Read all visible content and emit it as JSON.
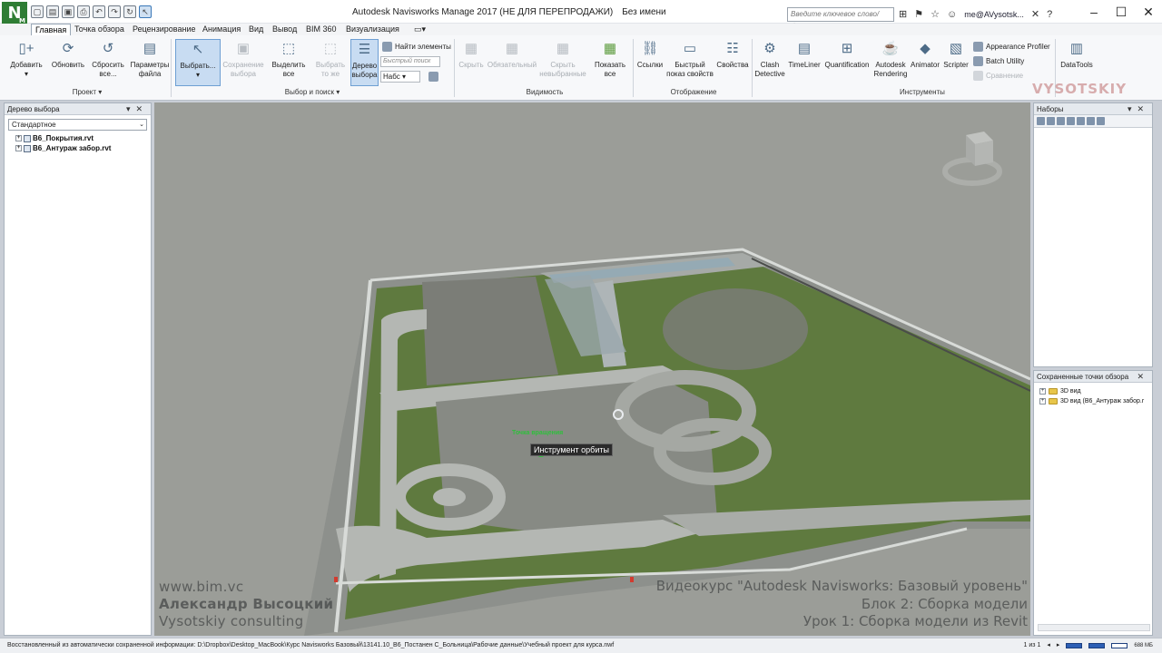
{
  "app": {
    "logo": "N",
    "logo_sub": "M",
    "title": "Autodesk Navisworks Manage 2017 (НЕ ДЛЯ ПЕРЕПРОДАЖИ)",
    "file_name": "Без имени",
    "search_placeholder": "Введите ключевое слово/фразу",
    "user": "me@AVysotsk..."
  },
  "tabs": [
    "Главная",
    "Точка обзора",
    "Рецензирование",
    "Анимация",
    "Вид",
    "Вывод",
    "BIM 360",
    "Визуализация"
  ],
  "active_tab": "Главная",
  "ribbon": {
    "project": {
      "label": "Проект ▾",
      "buttons": [
        "Добавить",
        "Обновить",
        "Сбросить все...",
        "Параметры файла"
      ]
    },
    "select_search": {
      "label": "Выбор и поиск ▾",
      "buttons": [
        "Выбрать...",
        "Сохранение выбора",
        "Выделить все",
        "Выбрать то же",
        "Дерево выбора"
      ],
      "find_items": "Найти элементы",
      "quick_find_placeholder": "Быстрый поиск",
      "sets_value": "Набс"
    },
    "visibility": {
      "label": "Видимость",
      "buttons": [
        "Скрыть",
        "Обязательный",
        "Скрыть невыбранные",
        "Показать все"
      ]
    },
    "display": {
      "label": "Отображение",
      "buttons": [
        "Ссылки",
        "Быстрый показ свойств",
        "Свойства"
      ]
    },
    "tools": {
      "label": "Инструменты",
      "buttons": [
        "Clash Detective",
        "TimeLiner",
        "Quantification",
        "Autodesk Rendering",
        "Animator",
        "Scripter"
      ],
      "small": [
        "Appearance Profiler",
        "Batch Utility",
        "Сравнение"
      ]
    },
    "datatools": "DataTools"
  },
  "left_panel": {
    "title": "Дерево выбора",
    "combo": "Стандартное",
    "items": [
      "В6_Покрытия.rvt",
      "В6_Антураж забор.rvt"
    ]
  },
  "viewport": {
    "pivot_label": "Точка вращения",
    "tooltip": "Инструмент орбиты",
    "watermark_left": [
      "www.bim.vc",
      "Александр Высоцкий",
      "Vysotskiy consulting"
    ],
    "watermark_right": [
      "Видеокурс \"Autodesk Navisworks: Базовый уровень\"",
      "Блок 2: Сборка модели",
      "Урок 1: Сборка модели из Revit"
    ],
    "brand": "VYSOTSKIY"
  },
  "sets_panel": {
    "title": "Наборы"
  },
  "saved_views_panel": {
    "title": "Сохраненные точки обзора",
    "items": [
      "3D вид",
      "3D вид (В6_Антураж забор.r"
    ]
  },
  "status": {
    "message": "Восстановленный из автоматически сохраненной информации: D:\\Dropbox\\Desktop_MacBook\\Курс Navisworks Базовый\\13141.10_В6_Постанен С_Больница\\Рабочие данные\\Учебный проект для курса.nwf",
    "page": "1 из 1",
    "memory": "688 МБ"
  }
}
